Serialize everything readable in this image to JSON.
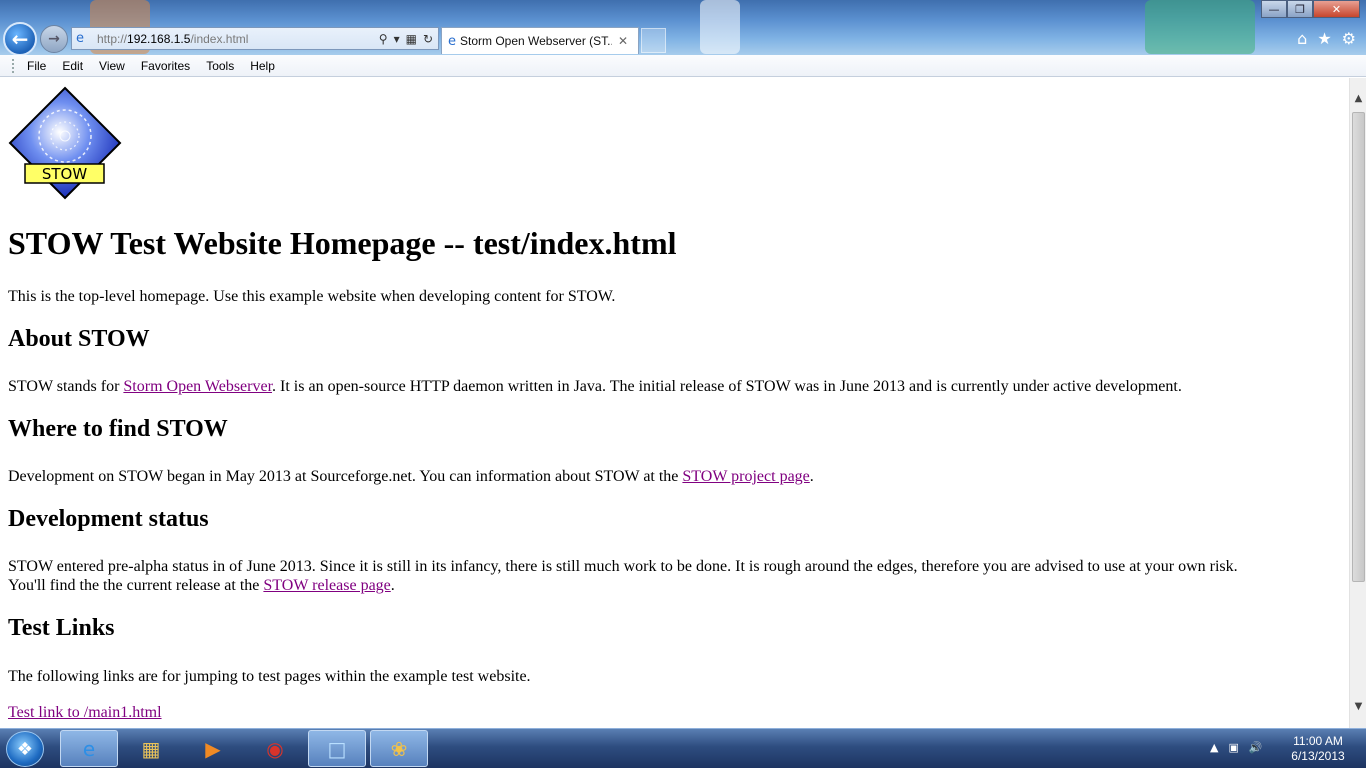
{
  "browser": {
    "address": {
      "prefix": "http://",
      "host": "192.168.1.5",
      "path": "/index.html"
    },
    "tab_title": "Storm Open Webserver (ST...",
    "menu": [
      "File",
      "Edit",
      "View",
      "Favorites",
      "Tools",
      "Help"
    ],
    "icons": {
      "back": "back-arrow-icon",
      "forward": "forward-arrow-icon",
      "search": "search-icon",
      "compat": "compatibility-icon",
      "refresh": "refresh-icon",
      "home": "home-icon",
      "favorites": "star-icon",
      "tools": "gear-icon"
    }
  },
  "page": {
    "logo_text": "STOW",
    "title": "STOW Test Website Homepage -- test/index.html",
    "intro": "This is the top-level homepage. Use this example website when developing content for STOW.",
    "about": {
      "heading": "About STOW",
      "before_link": "STOW stands for ",
      "link": "Storm Open Webserver",
      "after_link": ". It is an open-source HTTP daemon written in Java. The initial release of STOW was in June 2013 and is currently under active development."
    },
    "where": {
      "heading": "Where to find STOW",
      "before_link": "Development on STOW began in May 2013 at Sourceforge.net. You can information about STOW at the ",
      "link": "STOW project page",
      "after_link": "."
    },
    "status": {
      "heading": "Development status",
      "line1": "STOW entered pre-alpha status in of June 2013. Since it is still in its infancy, there is still much work to be done. It is rough around the edges, therefore you are advised to use at your own risk.",
      "before_link": "You'll find the the current release at the ",
      "link": "STOW release page",
      "after_link": "."
    },
    "tests": {
      "heading": "Test Links",
      "intro": "The following links are for jumping to test pages within the example test website.",
      "link1": "Test link to /main1.html"
    }
  },
  "taskbar": {
    "time": "11:00 AM",
    "date": "6/13/2013",
    "apps": [
      "internet-explorer",
      "windows-explorer",
      "media-player",
      "chrome",
      "app",
      "paint"
    ]
  },
  "colors": {
    "visited_link": "#800080",
    "taskbar": "#2e4d80"
  }
}
